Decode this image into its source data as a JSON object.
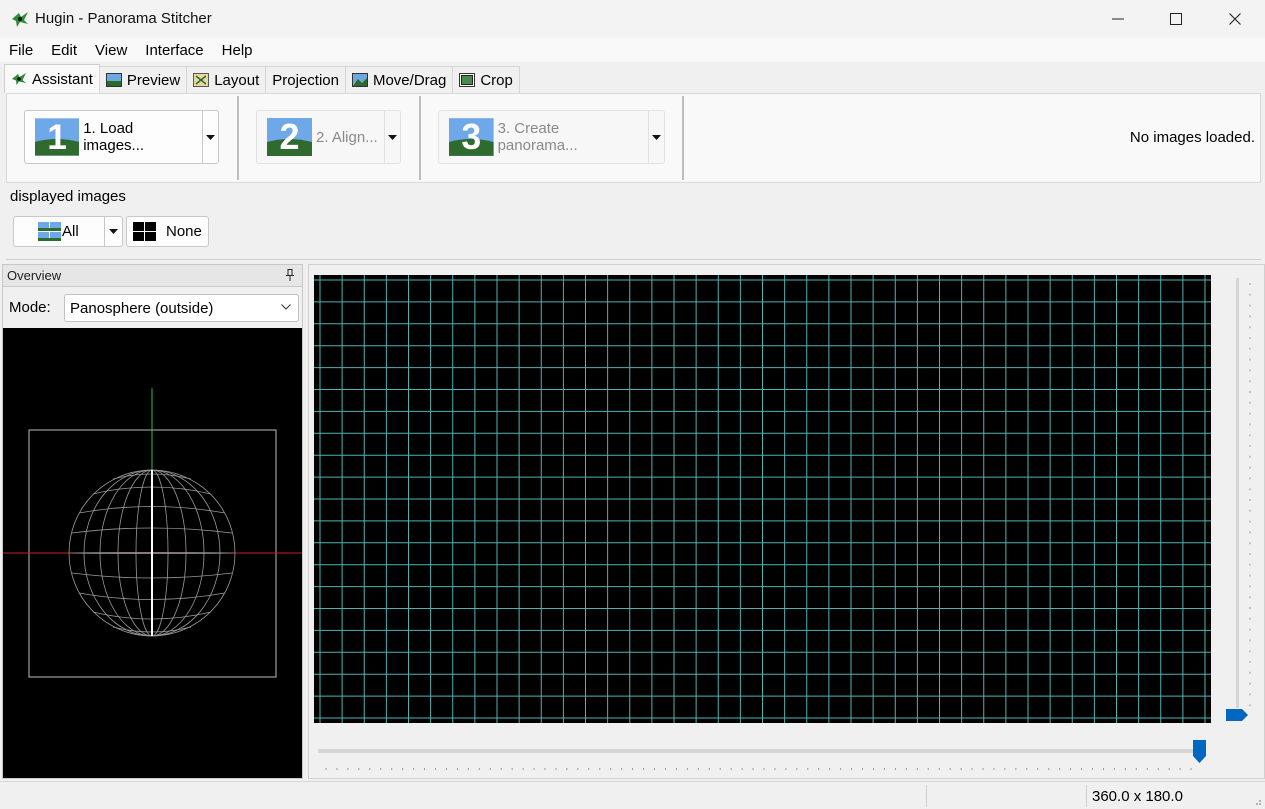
{
  "window": {
    "title": "Hugin - Panorama Stitcher"
  },
  "menu": {
    "items": [
      "File",
      "Edit",
      "View",
      "Interface",
      "Help"
    ]
  },
  "tabs": [
    {
      "label": "Assistant",
      "icon": "assistant-icon",
      "active": true
    },
    {
      "label": "Preview",
      "icon": "preview-icon",
      "active": false
    },
    {
      "label": "Layout",
      "icon": "layout-icon",
      "active": false
    },
    {
      "label": "Projection",
      "icon": "",
      "active": false
    },
    {
      "label": "Move/Drag",
      "icon": "move-drag-icon",
      "active": false
    },
    {
      "label": "Crop",
      "icon": "crop-icon",
      "active": false
    }
  ],
  "assistant": {
    "steps": [
      {
        "number": "1",
        "label": "1. Load images...",
        "enabled": true
      },
      {
        "number": "2",
        "label": "2. Align...",
        "enabled": false
      },
      {
        "number": "3",
        "label": "3. Create panorama...",
        "enabled": false
      }
    ],
    "status": "No images loaded."
  },
  "displayed_images": {
    "label": "displayed images",
    "all_label": "All",
    "none_label": "None"
  },
  "overview": {
    "title": "Overview",
    "mode_label": "Mode:",
    "mode_value": "Panosphere (outside)"
  },
  "statusbar": {
    "dimensions": "360.0 x 180.0"
  },
  "colors": {
    "grid_line": "#4fb3b3",
    "slider_accent": "#0067c0",
    "axis_green": "#2fbf2f",
    "axis_red": "#c81e1e"
  }
}
